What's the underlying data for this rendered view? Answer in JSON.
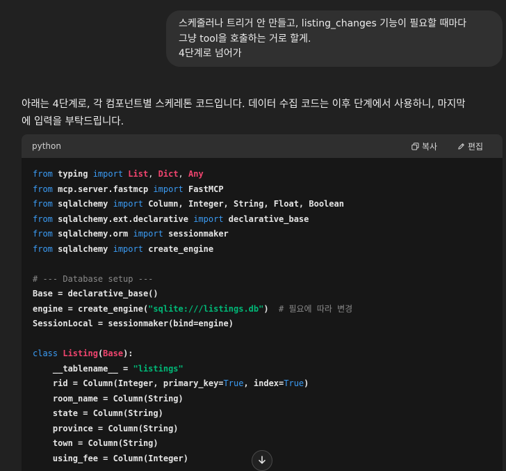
{
  "user_message": {
    "lines": [
      "스케줄러나 트리거 안 만들고, listing_changes 기능이 필요할 때마다",
      "그냥 tool을 호출하는 거로 할게.",
      "4단계로 넘어가"
    ]
  },
  "assistant_reply": {
    "intro_lines": [
      "아래는 4단계로, 각 컴포넌트별 스케레톤 코드입니다. 데이터 수집 코드는 이후 단계에서 사용하니, 마지막",
      "에 입력을 부탁드립니다."
    ]
  },
  "code_block": {
    "language": "python",
    "copy_label": "복사",
    "edit_label": "편집",
    "lines": [
      [
        [
          "kw",
          "from "
        ],
        [
          "bold",
          "typing "
        ],
        [
          "kw",
          "import "
        ],
        [
          "cls",
          "List"
        ],
        [
          "plain",
          ", "
        ],
        [
          "cls",
          "Dict"
        ],
        [
          "plain",
          ", "
        ],
        [
          "cls",
          "Any"
        ]
      ],
      [
        [
          "kw",
          "from "
        ],
        [
          "bold",
          "mcp.server.fastmcp "
        ],
        [
          "kw",
          "import "
        ],
        [
          "bold",
          "FastMCP"
        ]
      ],
      [
        [
          "kw",
          "from "
        ],
        [
          "bold",
          "sqlalchemy "
        ],
        [
          "kw",
          "import "
        ],
        [
          "bold",
          "Column, Integer, String, Float, Boolean"
        ]
      ],
      [
        [
          "kw",
          "from "
        ],
        [
          "bold",
          "sqlalchemy.ext.declarative "
        ],
        [
          "kw",
          "import "
        ],
        [
          "bold",
          "declarative_base"
        ]
      ],
      [
        [
          "kw",
          "from "
        ],
        [
          "bold",
          "sqlalchemy.orm "
        ],
        [
          "kw",
          "import "
        ],
        [
          "bold",
          "sessionmaker"
        ]
      ],
      [
        [
          "kw",
          "from "
        ],
        [
          "bold",
          "sqlalchemy "
        ],
        [
          "kw",
          "import "
        ],
        [
          "bold",
          "create_engine"
        ]
      ],
      [],
      [
        [
          "com",
          "# --- Database setup ---"
        ]
      ],
      [
        [
          "bold",
          "Base = declarative_base()"
        ]
      ],
      [
        [
          "bold",
          "engine = create_engine("
        ],
        [
          "str",
          "\"sqlite:///listings.db\""
        ],
        [
          "bold",
          ")  "
        ],
        [
          "com",
          "# 필요에 따라 변경"
        ]
      ],
      [
        [
          "bold",
          "SessionLocal = sessionmaker(bind=engine)"
        ]
      ],
      [],
      [
        [
          "kw",
          "class "
        ],
        [
          "cls",
          "Listing"
        ],
        [
          "bold",
          "("
        ],
        [
          "cls",
          "Base"
        ],
        [
          "bold",
          "):"
        ]
      ],
      [
        [
          "bold",
          "    __tablename__ = "
        ],
        [
          "str",
          "\"listings\""
        ]
      ],
      [
        [
          "bold",
          "    rid = Column(Integer, primary_key="
        ],
        [
          "kw",
          "True"
        ],
        [
          "bold",
          ", index="
        ],
        [
          "kw",
          "True"
        ],
        [
          "bold",
          ")"
        ]
      ],
      [
        [
          "bold",
          "    room_name = Column(String)"
        ]
      ],
      [
        [
          "bold",
          "    state = Column(String)"
        ]
      ],
      [
        [
          "bold",
          "    province = Column(String)"
        ]
      ],
      [
        [
          "bold",
          "    town = Column(String)"
        ]
      ],
      [
        [
          "bold",
          "    using_fee = Column(Integer)"
        ]
      ]
    ]
  },
  "icons": {
    "copy": "copy-icon",
    "edit": "edit-pen-icon",
    "scroll": "arrow-down-icon"
  },
  "colors": {
    "background": "#212121",
    "user_bubble": "#303030",
    "code_bg": "#171717",
    "code_header": "#2f2f2f",
    "keyword": "#3b9cf5",
    "class_name": "#f0446e",
    "string": "#00b877",
    "comment": "#8a8a8a"
  }
}
